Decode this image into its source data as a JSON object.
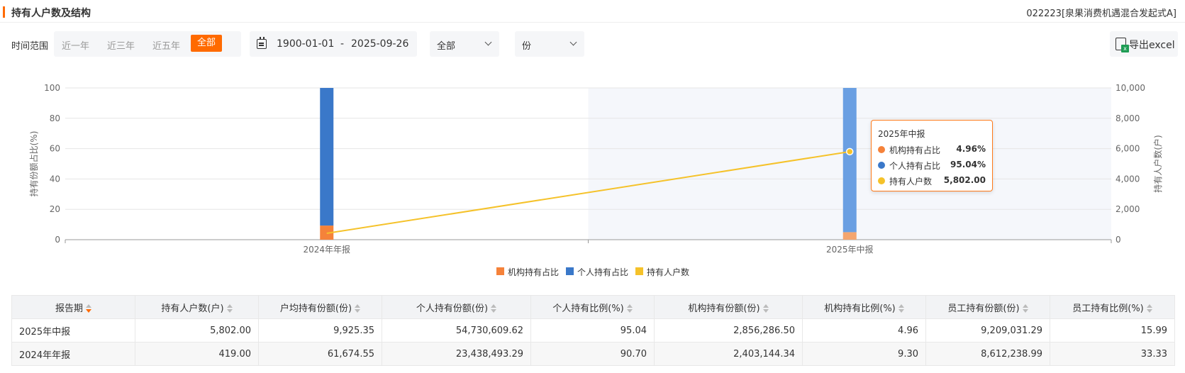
{
  "header": {
    "title": "持有人户数及结构",
    "fund_name": "022223[泉果消费机遇混合发起式A]"
  },
  "toolbar": {
    "range_label": "时间范围",
    "range_options": [
      "近一年",
      "近三年",
      "近五年",
      "全部"
    ],
    "range_selected": "全部",
    "date_start": "1900-01-01",
    "date_separator": "-",
    "date_end": "2025-09-26",
    "select_type": "全部",
    "select_unit": "份",
    "export_label": "导出excel"
  },
  "colors": {
    "accent": "#ff6a00",
    "institution": "#f5823a",
    "individual": "#3a78c9",
    "holders": "#f5c22a"
  },
  "chart_data": {
    "type": "bar",
    "categories": [
      "2024年年报",
      "2025年中报"
    ],
    "y_left_label": "持有份额占比(%)",
    "y_right_label": "持有人户数(户)",
    "y_left_ticks": [
      "0",
      "20",
      "40",
      "60",
      "80",
      "100"
    ],
    "y_right_ticks": [
      "0",
      "2,000",
      "4,000",
      "6,000",
      "8,000",
      "10,000"
    ],
    "ylim_left": [
      0,
      100
    ],
    "ylim_right": [
      0,
      10000
    ],
    "series": [
      {
        "name": "机构持有占比",
        "kind": "stacked-bar",
        "values": [
          9.3,
          4.96
        ]
      },
      {
        "name": "个人持有占比",
        "kind": "stacked-bar",
        "values": [
          90.7,
          95.04
        ]
      },
      {
        "name": "持有人户数",
        "kind": "line",
        "axis": "right",
        "values": [
          419.0,
          5802.0
        ]
      }
    ],
    "legend_position": "bottom",
    "highlighted_category": "2025年中报"
  },
  "tooltip": {
    "title": "2025年中报",
    "rows": [
      {
        "name": "机构持有占比",
        "value": "4.96%"
      },
      {
        "name": "个人持有占比",
        "value": "95.04%"
      },
      {
        "name": "持有人户数",
        "value": "5,802.00"
      }
    ]
  },
  "legend": [
    "机构持有占比",
    "个人持有占比",
    "持有人户数"
  ],
  "table": {
    "columns": [
      "报告期",
      "持有人户数(户)",
      "户均持有份额(份)",
      "个人持有份额(份)",
      "个人持有比例(%)",
      "机构持有份额(份)",
      "机构持有比例(%)",
      "员工持有份额(份)",
      "员工持有比例(%)"
    ],
    "rows": [
      [
        "2025年中报",
        "5,802.00",
        "9,925.35",
        "54,730,609.62",
        "95.04",
        "2,856,286.50",
        "4.96",
        "9,209,031.29",
        "15.99"
      ],
      [
        "2024年年报",
        "419.00",
        "61,674.55",
        "23,438,493.29",
        "90.70",
        "2,403,144.34",
        "9.30",
        "8,612,238.99",
        "33.33"
      ]
    ]
  }
}
